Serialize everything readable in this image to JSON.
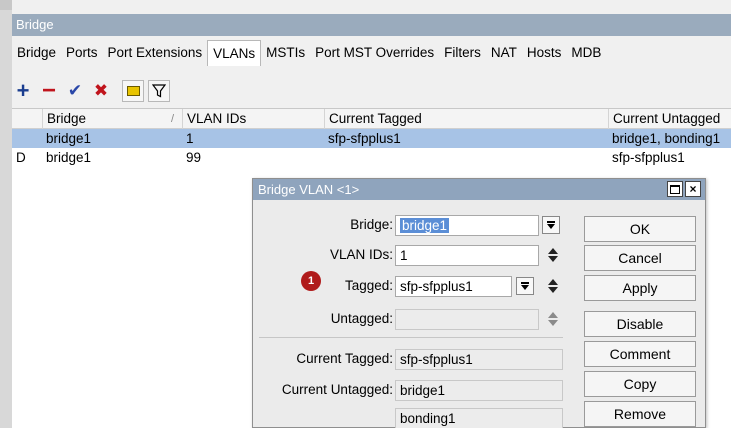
{
  "window": {
    "title": "Bridge"
  },
  "tabs": [
    "Bridge",
    "Ports",
    "Port Extensions",
    "VLANs",
    "MSTIs",
    "Port MST Overrides",
    "Filters",
    "NAT",
    "Hosts",
    "MDB"
  ],
  "active_tab": "VLANs",
  "toolbar": {
    "add_icon": "+",
    "remove_icon": "−",
    "enable_icon": "✔",
    "disable_icon": "✖",
    "comment_icon": "comment-icon",
    "filter_icon": "filter-icon",
    "colors": {
      "add": "#1a3d8f",
      "remove": "#c0141c",
      "enable": "#2a47a8",
      "disable": "#c0141c",
      "comment": "#e8c400"
    }
  },
  "table": {
    "columns": [
      "Bridge",
      "VLAN IDs",
      "Current Tagged",
      "Current Untagged"
    ],
    "sort_marker": "/",
    "rows": [
      {
        "flag": "",
        "bridge": "bridge1",
        "vlan_ids": "1",
        "current_tagged": "sfp-sfpplus1",
        "current_untagged": "bridge1, bonding1",
        "selected": true
      },
      {
        "flag": "D",
        "bridge": "bridge1",
        "vlan_ids": "99",
        "current_tagged": "",
        "current_untagged": "sfp-sfpplus1",
        "selected": false
      }
    ]
  },
  "dialog": {
    "title": "Bridge VLAN <1>",
    "close_glyph": "×",
    "badge": "1",
    "fields": {
      "bridge_label": "Bridge:",
      "bridge_value": "bridge1",
      "vlan_ids_label": "VLAN IDs:",
      "vlan_ids_value": "1",
      "tagged_label": "Tagged:",
      "tagged_value": "sfp-sfpplus1",
      "untagged_label": "Untagged:",
      "untagged_value": "",
      "current_tagged_label": "Current Tagged:",
      "current_tagged_value": "sfp-sfpplus1",
      "current_untagged_label": "Current Untagged:",
      "current_untagged_values": [
        "bridge1",
        "bonding1"
      ]
    },
    "buttons": [
      "OK",
      "Cancel",
      "Apply",
      "Disable",
      "Comment",
      "Copy",
      "Remove"
    ],
    "colors": {
      "title_bar": "#8fa4bd",
      "selection": "#5b8ed6",
      "badge": "#b01b1b"
    }
  },
  "colors": {
    "row_selected": "#a7c3e6",
    "window_title": "#9aabbd"
  }
}
